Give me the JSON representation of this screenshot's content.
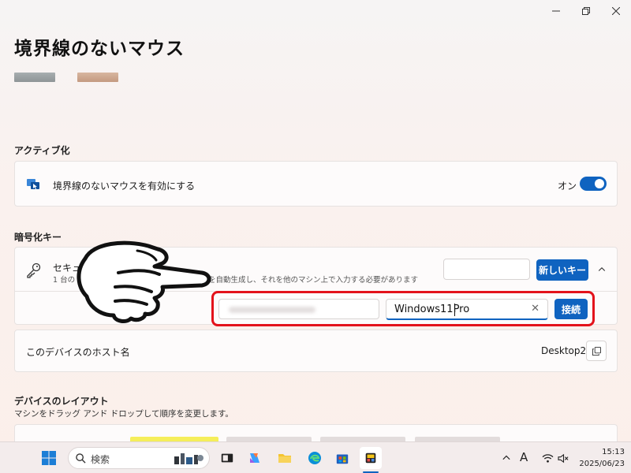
{
  "window": {
    "title": "境界線のないマウス",
    "colors": {
      "accent": "#0f63c0",
      "highlight": "#e3121b"
    }
  },
  "activation": {
    "section_label": "アクティブ化",
    "enable_label": "境界線のないマウスを有効にする",
    "toggle_state": "オン",
    "toggle_on": true
  },
  "encryption": {
    "section_label": "暗号化キー",
    "title": "セキュリ",
    "description_prefix": "1 台の",
    "description": "を自動生成し、それを他のマシン上で入力する必要があります",
    "new_key_button": "新しいキー",
    "connect": {
      "machine_name_value": "Windows11Pro",
      "connect_button": "接続"
    }
  },
  "host": {
    "label": "このデバイスのホスト名",
    "value": "Desktop2"
  },
  "layout": {
    "section_label": "デバイスのレイアウト",
    "description": "マシンをドラッグ アンド ドロップして順序を変更します。"
  },
  "taskbar": {
    "search_label": "検索",
    "ime_indicator": "A",
    "clock_time": "15:13",
    "clock_date": "2025/06/23"
  }
}
